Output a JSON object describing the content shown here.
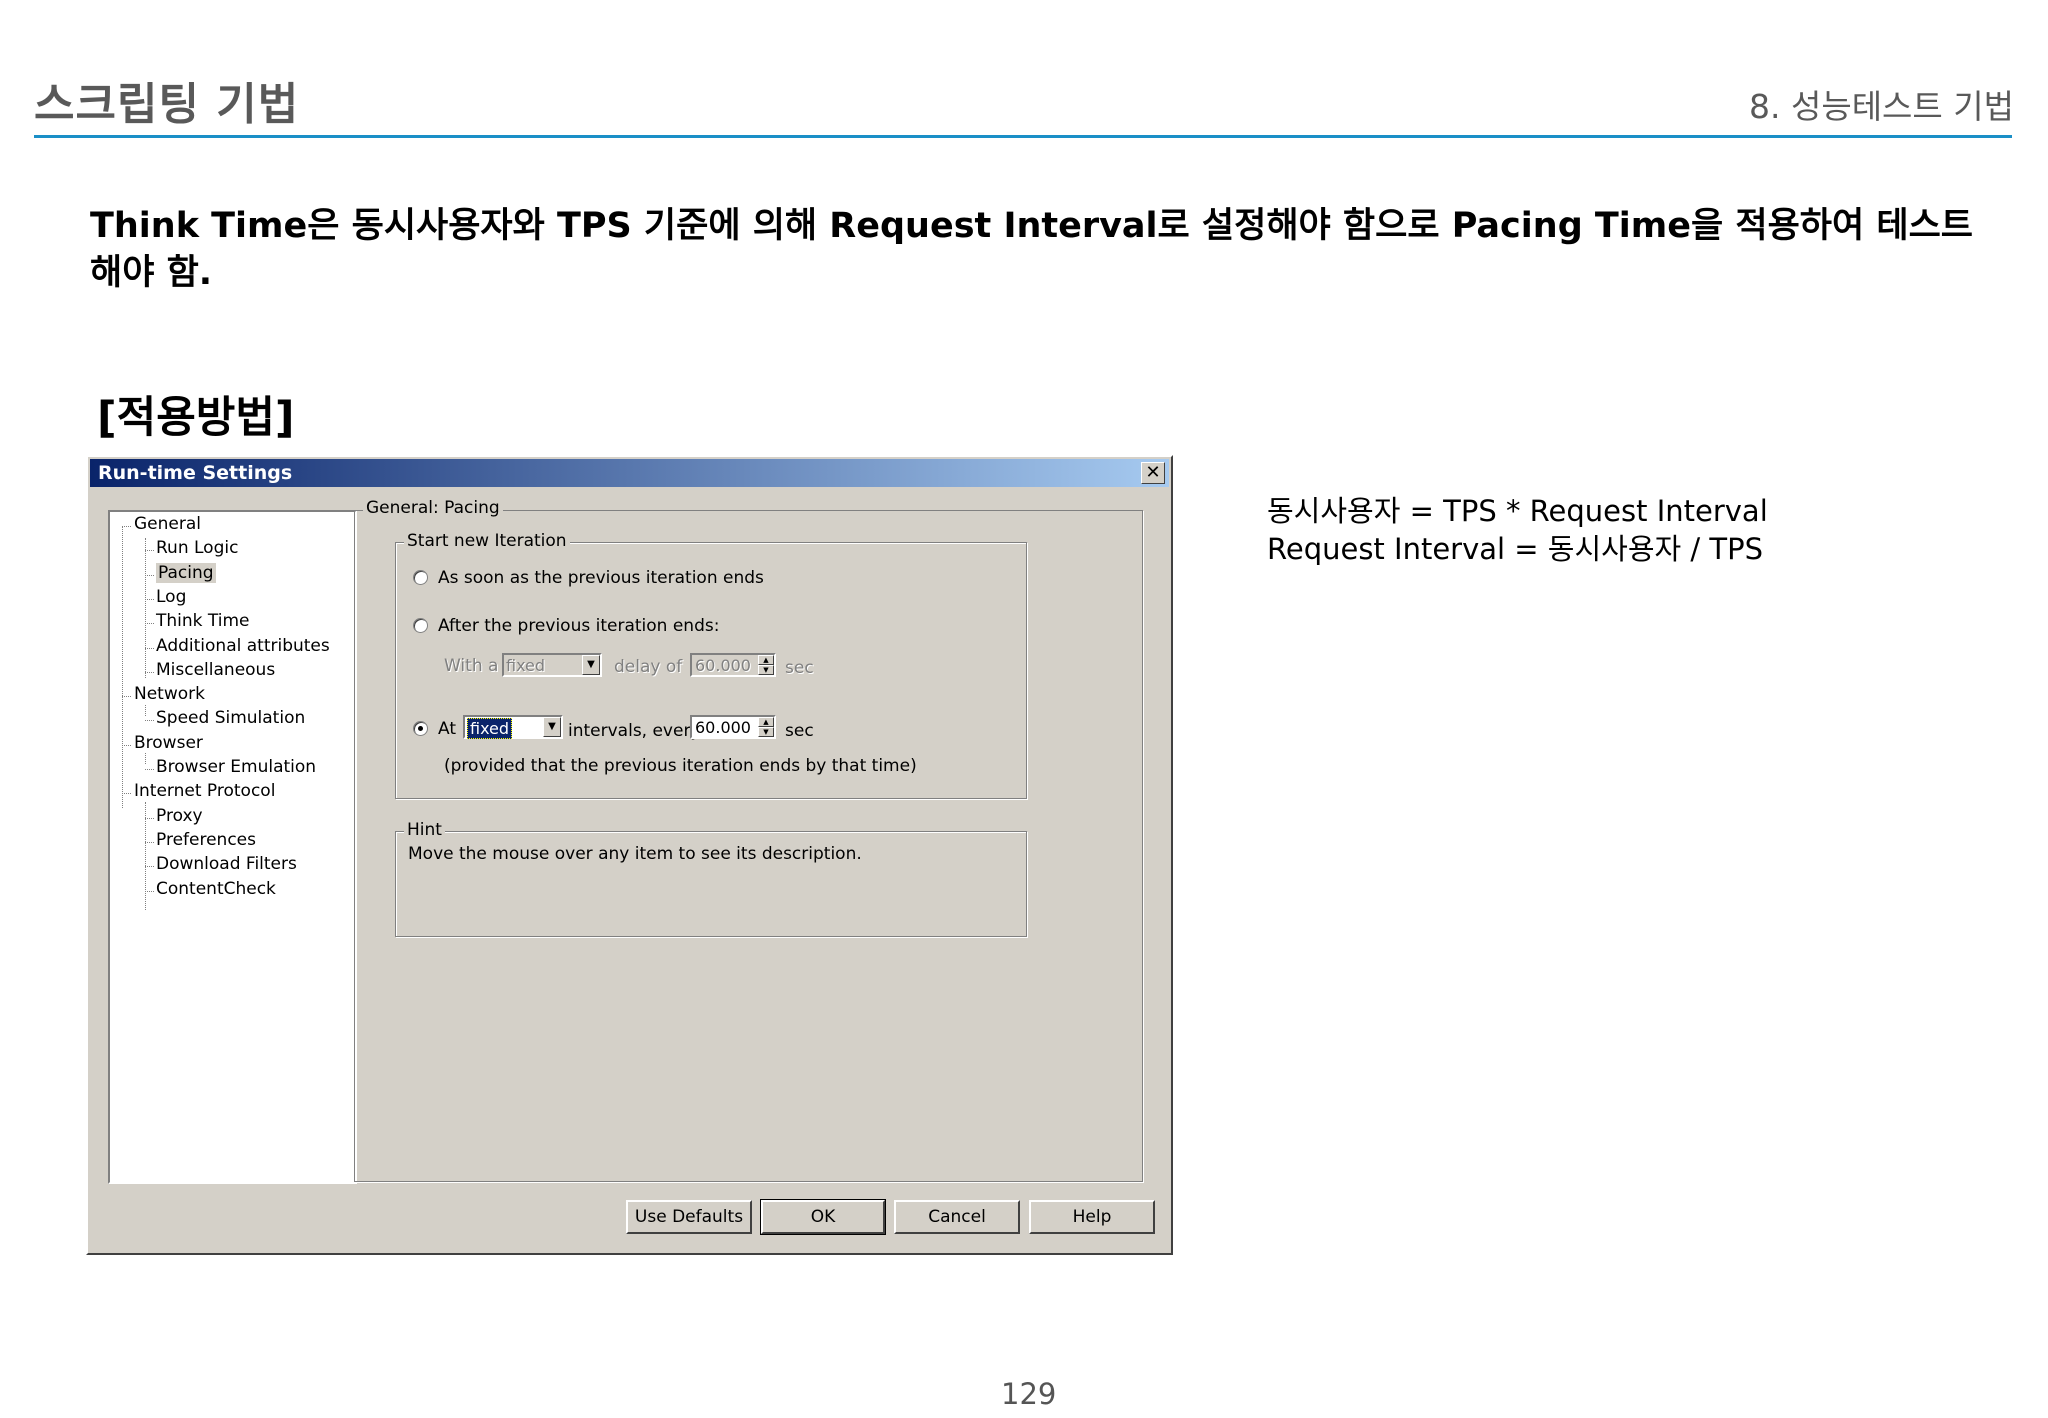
{
  "slide": {
    "title": "스크립팅 기법",
    "section": "8. 성능테스트 기법",
    "headline": "Think Time은 동시사용자와 TPS 기준에 의해 Request Interval로 설정해야 함으로 Pacing Time을 적용하여 테스트 해야 함.",
    "method_heading": "[적용방법]",
    "formula_1": "동시사용자 = TPS * Request Interval",
    "formula_2": "Request Interval = 동시사용자 / TPS",
    "page_number": "129"
  },
  "dialog": {
    "title": "Run-time Settings",
    "close_glyph": "✕",
    "tree": [
      {
        "label": "General",
        "level": 0
      },
      {
        "label": "Run Logic",
        "level": 1
      },
      {
        "label": "Pacing",
        "level": 1,
        "selected": true
      },
      {
        "label": "Log",
        "level": 1
      },
      {
        "label": "Think Time",
        "level": 1
      },
      {
        "label": "Additional attributes",
        "level": 1
      },
      {
        "label": "Miscellaneous",
        "level": 1
      },
      {
        "label": "Network",
        "level": 0
      },
      {
        "label": "Speed Simulation",
        "level": 1
      },
      {
        "label": "Browser",
        "level": 0
      },
      {
        "label": "Browser Emulation",
        "level": 1
      },
      {
        "label": "Internet Protocol",
        "level": 0
      },
      {
        "label": "Proxy",
        "level": 1
      },
      {
        "label": "Preferences",
        "level": 1
      },
      {
        "label": "Download Filters",
        "level": 1
      },
      {
        "label": "ContentCheck",
        "level": 1
      }
    ],
    "pane_title": "General: Pacing",
    "start_group_label": "Start new Iteration",
    "option_asap": "As soon as the previous iteration ends",
    "option_after": "After the previous iteration ends:",
    "with_a": "With a",
    "after_combo_value": "fixed",
    "delay_of": "delay of",
    "after_delay_value": "60.000",
    "sec_1": "sec",
    "option_at": "At",
    "at_combo_value": "fixed",
    "intervals_every": "intervals, every",
    "at_interval_value": "60.000",
    "sec_2": "sec",
    "provided_note": "(provided that the previous iteration ends by that time)",
    "hint_label": "Hint",
    "hint_text": "Move the mouse over any item to see its description.",
    "selected_option": "at",
    "buttons": {
      "use_defaults": "Use Defaults",
      "ok": "OK",
      "cancel": "Cancel",
      "help": "Help"
    }
  }
}
